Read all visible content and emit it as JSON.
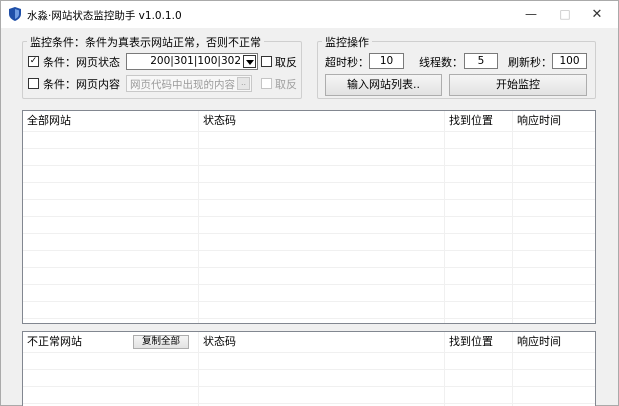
{
  "window": {
    "title": "水淼·网站状态监控助手 v1.0.1.0",
    "minimize": "—",
    "maximize": "□",
    "close": "✕"
  },
  "condition_group": {
    "legend": "监控条件：条件为真表示网站正常，否则不正常",
    "row1": {
      "checked": true,
      "label": "条件：网页状态",
      "codes": "200|301|100|302",
      "negate_label": "取反"
    },
    "row2": {
      "checked": false,
      "label": "条件：网页内容",
      "placeholder": "网页代码中出现的内容",
      "more": "..",
      "negate_label": "取反"
    }
  },
  "monitor_group": {
    "legend": "监控操作",
    "timeout_label": "超时秒：",
    "timeout_value": "10",
    "threads_label": "线程数：",
    "threads_value": "5",
    "refresh_label": "刷新秒：",
    "refresh_value": "100",
    "import_button": "输入网站列表..",
    "start_button": "开始监控"
  },
  "all_sites_list": {
    "columns": [
      "全部网站",
      "状态码",
      "找到位置",
      "响应时间"
    ]
  },
  "abnormal_list": {
    "columns": [
      "不正常网站",
      "状态码",
      "找到位置",
      "响应时间"
    ],
    "copy_all_button": "复制全部"
  },
  "colors": {
    "window_bg": "#f0f0f0",
    "icon": "#1f4fa8"
  }
}
